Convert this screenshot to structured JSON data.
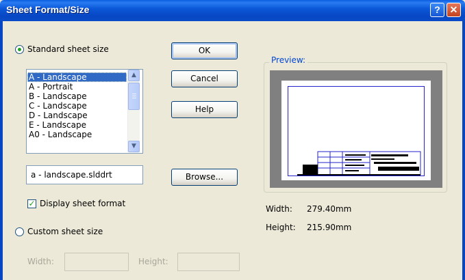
{
  "window": {
    "title": "Sheet Format/Size",
    "help_glyph": "?",
    "close_glyph": "✕"
  },
  "standard": {
    "label": "Standard sheet size",
    "selected": true,
    "sizes": [
      {
        "label": "A - Landscape",
        "selected": true
      },
      {
        "label": "A - Portrait",
        "selected": false
      },
      {
        "label": "B - Landscape",
        "selected": false
      },
      {
        "label": "C - Landscape",
        "selected": false
      },
      {
        "label": "D - Landscape",
        "selected": false
      },
      {
        "label": "E - Landscape",
        "selected": false
      },
      {
        "label": "A0 - Landscape",
        "selected": false
      }
    ],
    "format_file": "a - landscape.slddrt",
    "display_format_label": "Display sheet format",
    "display_format_checked": true
  },
  "custom": {
    "label": "Custom sheet size",
    "selected": false,
    "width_label": "Width:",
    "height_label": "Height:",
    "width_value": "",
    "height_value": ""
  },
  "buttons": {
    "ok": "OK",
    "cancel": "Cancel",
    "help": "Help",
    "browse": "Browse..."
  },
  "preview": {
    "label": "Preview:",
    "width_label": "Width:",
    "width_value": "279.40mm",
    "height_label": "Height:",
    "height_value": "215.90mm"
  },
  "colors": {
    "titlebar": "#0a4bc8",
    "selection": "#316ac5",
    "group_label": "#0046d5",
    "sheet_border": "#2222cc"
  }
}
